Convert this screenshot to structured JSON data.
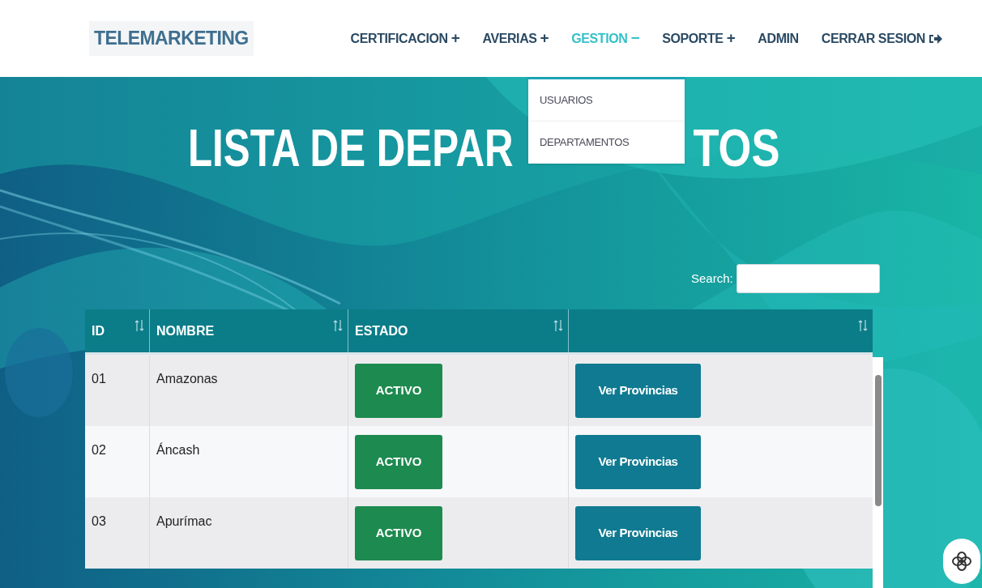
{
  "navbar": {
    "logo": "TELEMARKETING",
    "items": [
      {
        "label": "CERTIFICACION",
        "sign": "+",
        "kind": "menu",
        "selected": false
      },
      {
        "label": "AVERIAS",
        "sign": "+",
        "kind": "menu",
        "selected": false
      },
      {
        "label": "GESTION",
        "sign": "−",
        "kind": "menu",
        "selected": true
      },
      {
        "label": "SOPORTE",
        "sign": "+",
        "kind": "menu",
        "selected": false
      },
      {
        "label": "ADMIN",
        "kind": "link",
        "selected": false
      },
      {
        "label": "CERRAR SESION",
        "kind": "logout",
        "selected": false
      }
    ],
    "dropdown": [
      "USUARIOS",
      "DEPARTAMENTOS"
    ]
  },
  "page_title": [
    "LISTA DE DEPAR",
    "TOS"
  ],
  "search": {
    "label": "Search:"
  },
  "table": {
    "columns": [
      {
        "label": "ID"
      },
      {
        "label": "NOMBRE"
      },
      {
        "label": "ESTADO"
      },
      {}
    ],
    "rows": [
      {
        "id": "01",
        "nombre": "Amazonas",
        "estado": "ACTIVO",
        "action": "Ver Provincias"
      },
      {
        "id": "02",
        "nombre": "Áncash",
        "estado": "ACTIVO",
        "action": "Ver Provincias"
      },
      {
        "id": "03",
        "nombre": "Apurímac",
        "estado": "ACTIVO",
        "action": "Ver Provincias"
      }
    ]
  }
}
